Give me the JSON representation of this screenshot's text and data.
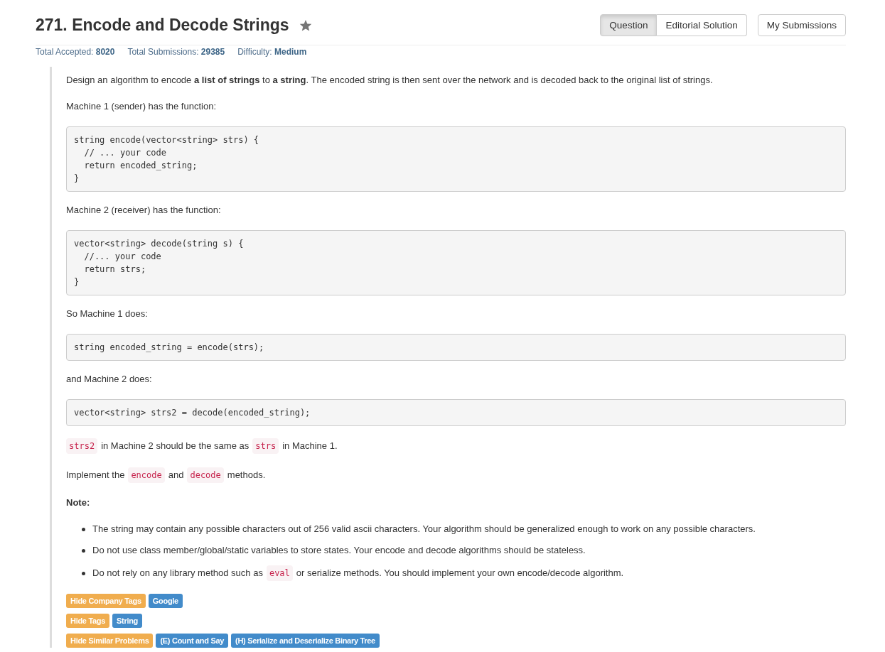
{
  "title": "271. Encode and Decode Strings",
  "starred": true,
  "tabs": [
    {
      "label": "Question",
      "selected": true
    },
    {
      "label": "Editorial Solution",
      "selected": false
    }
  ],
  "submissions_button": "My Submissions",
  "stats": [
    {
      "label": "Total Accepted:",
      "value": "8020"
    },
    {
      "label": "Total Submissions:",
      "value": "29385"
    },
    {
      "label": "Difficulty:",
      "value": "Medium"
    }
  ],
  "blocks": [
    {
      "kind": "text",
      "segments": [
        {
          "kind": "text",
          "text": "Design an algorithm to encode **a list of strings** to **a string**. The encoded string is then sent over the network and is decoded back to the original list of strings."
        }
      ]
    },
    {
      "kind": "text",
      "segments": [
        {
          "kind": "text",
          "text": "Machine 1 (sender) has the function:"
        }
      ]
    },
    {
      "kind": "code",
      "lines": [
        "string encode(vector<string> strs) {",
        "  // ... your code",
        "  return encoded_string;",
        "}"
      ]
    },
    {
      "kind": "text",
      "segments": [
        {
          "kind": "text",
          "text": "Machine 2 (receiver) has the function:"
        }
      ]
    },
    {
      "kind": "code",
      "lines": [
        "vector<string> decode(string s) {",
        "  //... your code",
        "  return strs;",
        "}"
      ]
    },
    {
      "kind": "text",
      "segments": [
        {
          "kind": "text",
          "text": "So Machine 1 does:"
        }
      ]
    },
    {
      "kind": "code",
      "lines": [
        "string encoded_string = encode(strs);"
      ]
    },
    {
      "kind": "text",
      "segments": [
        {
          "kind": "text",
          "text": "and Machine 2 does:"
        }
      ]
    },
    {
      "kind": "code",
      "lines": [
        "vector<string> strs2 = decode(encoded_string);"
      ]
    },
    {
      "kind": "text",
      "segments": [
        {
          "kind": "code",
          "text": "strs2"
        },
        {
          "kind": "text",
          "text": "in Machine 2 should be the same as"
        },
        {
          "kind": "code",
          "text": "strs"
        },
        {
          "kind": "text",
          "text": "in Machine 1."
        }
      ]
    },
    {
      "kind": "text",
      "segments": [
        {
          "kind": "text",
          "text": "Implement the"
        },
        {
          "kind": "code",
          "text": "encode"
        },
        {
          "kind": "text",
          "text": "and"
        },
        {
          "kind": "code",
          "text": "decode"
        },
        {
          "kind": "text",
          "text": "methods."
        }
      ]
    },
    {
      "kind": "heading",
      "segments": [
        {
          "kind": "text",
          "text": "Note:"
        }
      ]
    },
    {
      "kind": "list",
      "items": [
        [
          {
            "kind": "text",
            "text": "The string may contain any possible characters out of 256 valid ascii characters. Your algorithm should be generalized enough to work on any possible characters."
          }
        ],
        [
          {
            "kind": "text",
            "text": "Do not use class member/global/static variables to store states. Your encode and decode algorithms should be stateless."
          }
        ],
        [
          {
            "kind": "text",
            "text": "Do not rely on any library method such as"
          },
          {
            "kind": "code",
            "text": "eval"
          },
          {
            "kind": "text",
            "text": "or serialize methods. You should implement your own encode/decode algorithm."
          }
        ]
      ]
    }
  ],
  "tag_rows": [
    {
      "toggle": "Hide Company Tags",
      "tags": [
        "Google"
      ]
    },
    {
      "toggle": "Hide Tags",
      "tags": [
        "String"
      ]
    },
    {
      "toggle": "Hide Similar Problems",
      "tags": [
        "(E) Count and Say",
        "(H) Serialize and Deserialize Binary Tree"
      ]
    }
  ]
}
